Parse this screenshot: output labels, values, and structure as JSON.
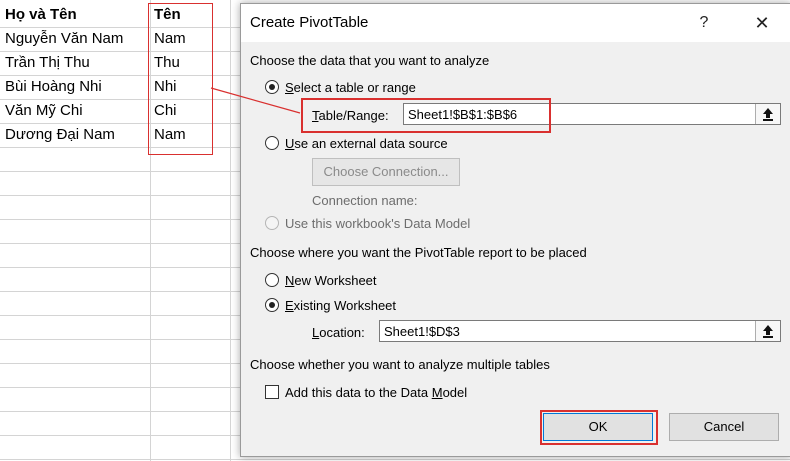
{
  "spreadsheet": {
    "header_a": "Họ và Tên",
    "header_b": "Tên",
    "rows": [
      {
        "full_name": "Nguyễn Văn Nam",
        "first_name": "Nam"
      },
      {
        "full_name": "Trần Thị Thu",
        "first_name": "Thu"
      },
      {
        "full_name": "Bùi Hoàng Nhi",
        "first_name": "Nhi"
      },
      {
        "full_name": "Văn Mỹ Chi",
        "first_name": "Chi"
      },
      {
        "full_name": "Dương Đại Nam",
        "first_name": "Nam"
      }
    ]
  },
  "dialog": {
    "title": "Create PivotTable",
    "help_glyph": "?",
    "close_glyph": "✕",
    "section_data_heading": "Choose the data that you want to analyze",
    "option_select_range": {
      "accel": "S",
      "rest": "elect a table or range",
      "selected": true
    },
    "table_range": {
      "label_accel": "T",
      "label_rest": "able/Range:",
      "value": "Sheet1!$B$1:$B$6"
    },
    "option_external": {
      "accel": "U",
      "rest": "se an external data source",
      "selected": false
    },
    "choose_connection_button": "Choose Connection...",
    "connection_name_label": "Connection name:",
    "option_data_model": {
      "label": "Use this workbook's Data Model",
      "enabled": false
    },
    "section_place_heading": "Choose where you want the PivotTable report to be placed",
    "option_new_worksheet": {
      "accel": "N",
      "rest": "ew Worksheet",
      "selected": false
    },
    "option_existing_worksheet": {
      "accel": "E",
      "rest": "xisting Worksheet",
      "selected": true
    },
    "location": {
      "label_accel": "L",
      "label_rest": "ocation:",
      "value": "Sheet1!$D$3"
    },
    "section_multi_heading": "Choose whether you want to analyze multiple tables",
    "add_to_data_model": {
      "pre": "Add this data to the Data ",
      "accel": "M",
      "post": "odel",
      "checked": false
    },
    "ok_button": "OK",
    "cancel_button": "Cancel"
  },
  "colors": {
    "highlight_red": "#d9302f",
    "dialog_bg": "#f0f0f0",
    "ok_focus": "#0078d7"
  }
}
